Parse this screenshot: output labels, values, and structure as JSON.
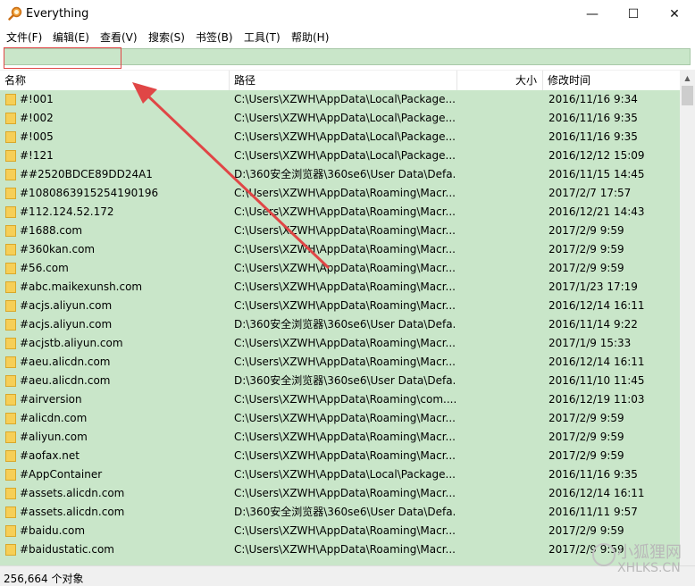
{
  "window": {
    "title": "Everything",
    "minimize": "—",
    "maximize": "☐",
    "close": "✕"
  },
  "menu": [
    "文件(F)",
    "编辑(E)",
    "查看(V)",
    "搜索(S)",
    "书签(B)",
    "工具(T)",
    "帮助(H)"
  ],
  "search": {
    "value": ""
  },
  "columns": {
    "name": "名称",
    "path": "路径",
    "size": "大小",
    "modified": "修改时间"
  },
  "rows": [
    {
      "name": "#!001",
      "path": "C:\\Users\\XZWH\\AppData\\Local\\Package...",
      "modified": "2016/11/16 9:34"
    },
    {
      "name": "#!002",
      "path": "C:\\Users\\XZWH\\AppData\\Local\\Package...",
      "modified": "2016/11/16 9:35"
    },
    {
      "name": "#!005",
      "path": "C:\\Users\\XZWH\\AppData\\Local\\Package...",
      "modified": "2016/11/16 9:35"
    },
    {
      "name": "#!121",
      "path": "C:\\Users\\XZWH\\AppData\\Local\\Package...",
      "modified": "2016/12/12 15:09"
    },
    {
      "name": "##2520BDCE89DD24A1",
      "path": "D:\\360安全浏览器\\360se6\\User Data\\Defa...",
      "modified": "2016/11/15 14:45"
    },
    {
      "name": "#1080863915254190196",
      "path": "C:\\Users\\XZWH\\AppData\\Roaming\\Macr...",
      "modified": "2017/2/7 17:57"
    },
    {
      "name": "#112.124.52.172",
      "path": "C:\\Users\\XZWH\\AppData\\Roaming\\Macr...",
      "modified": "2016/12/21 14:43"
    },
    {
      "name": "#1688.com",
      "path": "C:\\Users\\XZWH\\AppData\\Roaming\\Macr...",
      "modified": "2017/2/9 9:59"
    },
    {
      "name": "#360kan.com",
      "path": "C:\\Users\\XZWH\\AppData\\Roaming\\Macr...",
      "modified": "2017/2/9 9:59"
    },
    {
      "name": "#56.com",
      "path": "C:\\Users\\XZWH\\AppData\\Roaming\\Macr...",
      "modified": "2017/2/9 9:59"
    },
    {
      "name": "#abc.maikexunsh.com",
      "path": "C:\\Users\\XZWH\\AppData\\Roaming\\Macr...",
      "modified": "2017/1/23 17:19"
    },
    {
      "name": "#acjs.aliyun.com",
      "path": "C:\\Users\\XZWH\\AppData\\Roaming\\Macr...",
      "modified": "2016/12/14 16:11"
    },
    {
      "name": "#acjs.aliyun.com",
      "path": "D:\\360安全浏览器\\360se6\\User Data\\Defa...",
      "modified": "2016/11/14 9:22"
    },
    {
      "name": "#acjstb.aliyun.com",
      "path": "C:\\Users\\XZWH\\AppData\\Roaming\\Macr...",
      "modified": "2017/1/9 15:33"
    },
    {
      "name": "#aeu.alicdn.com",
      "path": "C:\\Users\\XZWH\\AppData\\Roaming\\Macr...",
      "modified": "2016/12/14 16:11"
    },
    {
      "name": "#aeu.alicdn.com",
      "path": "D:\\360安全浏览器\\360se6\\User Data\\Defa...",
      "modified": "2016/11/10 11:45"
    },
    {
      "name": "#airversion",
      "path": "C:\\Users\\XZWH\\AppData\\Roaming\\com....",
      "modified": "2016/12/19 11:03"
    },
    {
      "name": "#alicdn.com",
      "path": "C:\\Users\\XZWH\\AppData\\Roaming\\Macr...",
      "modified": "2017/2/9 9:59"
    },
    {
      "name": "#aliyun.com",
      "path": "C:\\Users\\XZWH\\AppData\\Roaming\\Macr...",
      "modified": "2017/2/9 9:59"
    },
    {
      "name": "#aofax.net",
      "path": "C:\\Users\\XZWH\\AppData\\Roaming\\Macr...",
      "modified": "2017/2/9 9:59"
    },
    {
      "name": "#AppContainer",
      "path": "C:\\Users\\XZWH\\AppData\\Local\\Package...",
      "modified": "2016/11/16 9:35"
    },
    {
      "name": "#assets.alicdn.com",
      "path": "C:\\Users\\XZWH\\AppData\\Roaming\\Macr...",
      "modified": "2016/12/14 16:11"
    },
    {
      "name": "#assets.alicdn.com",
      "path": "D:\\360安全浏览器\\360se6\\User Data\\Defa...",
      "modified": "2016/11/11 9:57"
    },
    {
      "name": "#baidu.com",
      "path": "C:\\Users\\XZWH\\AppData\\Roaming\\Macr...",
      "modified": "2017/2/9 9:59"
    },
    {
      "name": "#baidustatic.com",
      "path": "C:\\Users\\XZWH\\AppData\\Roaming\\Macr...",
      "modified": "2017/2/9 9:59"
    }
  ],
  "status": {
    "count": "256,664 个对象"
  },
  "watermark": {
    "line1": "小狐狸网",
    "line2": "XHLKS.CN"
  },
  "colors": {
    "list_bg": "#c9e6c9",
    "annotation": "#e04646",
    "folder": "#f6cf57"
  },
  "icons": {
    "app": "magnifier-icon",
    "row": "folder-icon"
  }
}
